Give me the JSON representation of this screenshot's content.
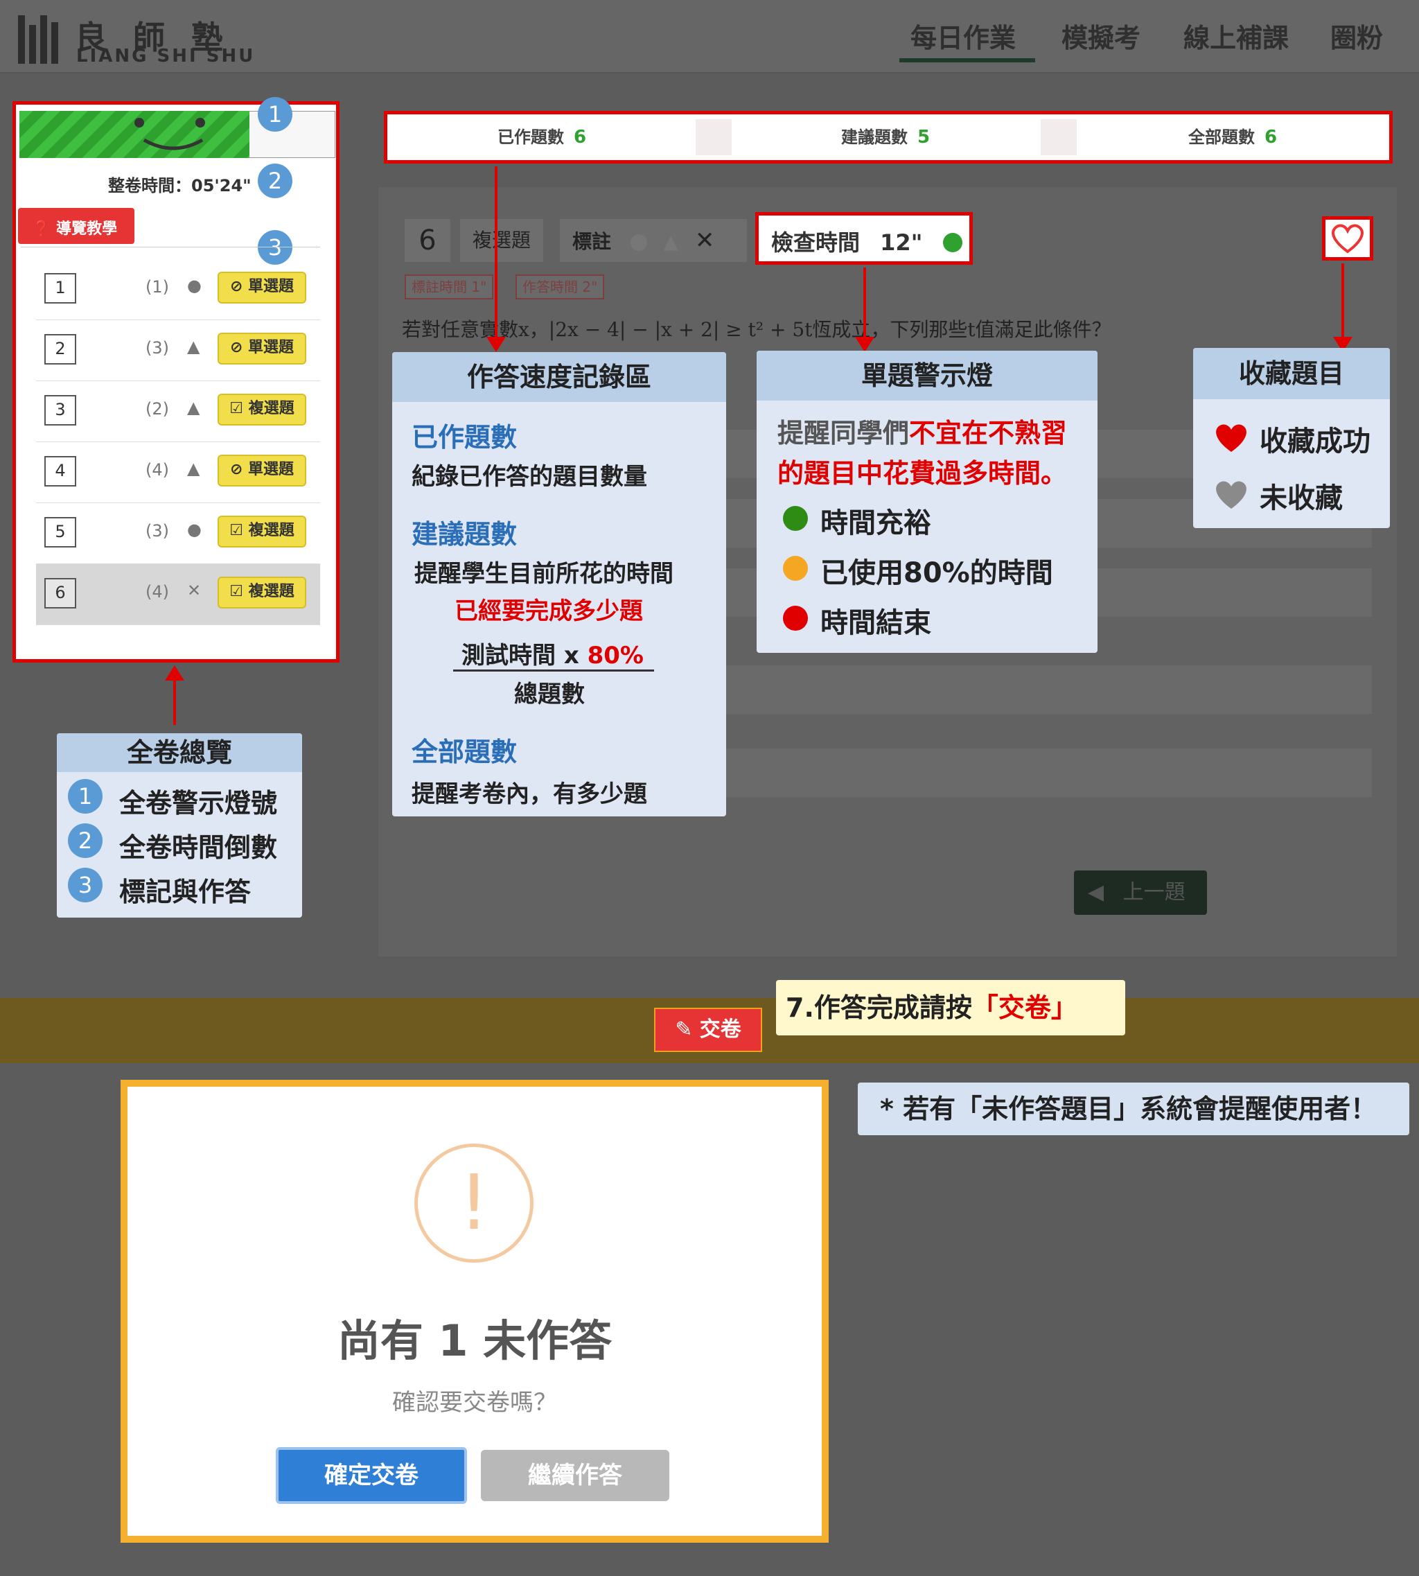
{
  "header": {
    "logo_cn": "良師塾",
    "logo_en": "LIANG SHI SHU",
    "nav": [
      "每日作業",
      "模擬考",
      "線上補課",
      "圈粉"
    ],
    "active_nav": "每日作業"
  },
  "overview": {
    "time_label": "整卷時間：05'24\"",
    "guide_button": "導覽教學",
    "badges": [
      "1",
      "2",
      "3"
    ],
    "questions": [
      {
        "num": "1",
        "points": "(1)",
        "mark": "●",
        "type": "單選題"
      },
      {
        "num": "2",
        "points": "(3)",
        "mark": "▲",
        "type": "單選題"
      },
      {
        "num": "3",
        "points": "(2)",
        "mark": "▲",
        "type": "複選題"
      },
      {
        "num": "4",
        "points": "(4)",
        "mark": "▲",
        "type": "單選題"
      },
      {
        "num": "5",
        "points": "(3)",
        "mark": "●",
        "type": "複選題"
      },
      {
        "num": "6",
        "points": "(4)",
        "mark": "✕",
        "type": "複選題"
      }
    ]
  },
  "counters": {
    "done_label": "已作題數",
    "done_value": "6",
    "suggest_label": "建議題數",
    "suggest_value": "5",
    "total_label": "全部題數",
    "total_value": "6"
  },
  "question": {
    "number": "6",
    "type": "複選題",
    "mark_label": "標註",
    "check_time_label": "檢查時間",
    "check_time_value": "12\"",
    "mark_time_label": "標註時間",
    "mark_time_value": "1\"",
    "answer_time_label": "作答時間",
    "answer_time_value": "2\"",
    "text": "若對任意實數x，|2x − 4| − |x + 2| ≥ t² + 5t恆成立，下列那些t值滿足此條件？",
    "prev_button": "上一題"
  },
  "annotations": {
    "overview_box": {
      "title": "全卷總覽",
      "items": [
        "全卷警示燈號",
        "全卷時間倒數",
        "標記與作答"
      ]
    },
    "speed_box": {
      "title": "作答速度記錄區",
      "done_h": "已作題數",
      "done_desc": "紀錄已作答的題目數量",
      "suggest_h": "建議題數",
      "suggest_desc1": "提醒學生目前所花的時間",
      "suggest_desc2": "已經要完成多少題",
      "formula_num": "測試時間 x ",
      "formula_pct": "80%",
      "formula_den": "總題數",
      "total_h": "全部題數",
      "total_desc": "提醒考卷內，有多少題"
    },
    "light_box": {
      "title": "單題警示燈",
      "desc_a": "提醒同學們",
      "desc_b": "不宜在不熟習",
      "desc_c": "的題目中花費過多時間。",
      "green": "時間充裕",
      "orange": "已使用80%的時間",
      "red": "時間結束"
    },
    "fav_box": {
      "title": "收藏題目",
      "saved": "收藏成功",
      "unsaved": "未收藏"
    },
    "step7_a": "7.作答完成請按",
    "step7_b": "「交卷」",
    "unanswered_note": "* 若有「未作答題目」系統會提醒使用者！"
  },
  "submit_button": "交卷",
  "dialog": {
    "icon": "!",
    "title": "尚有 1 未作答",
    "subtitle": "確認要交卷嗎？",
    "confirm": "確定交卷",
    "continue": "繼續作答"
  },
  "colors": {
    "alert_red": "#e10000",
    "green": "#2ea12e",
    "orange": "#f5a623",
    "blue": "#2f7fd6",
    "yellow_tag": "#f2dd4a"
  }
}
